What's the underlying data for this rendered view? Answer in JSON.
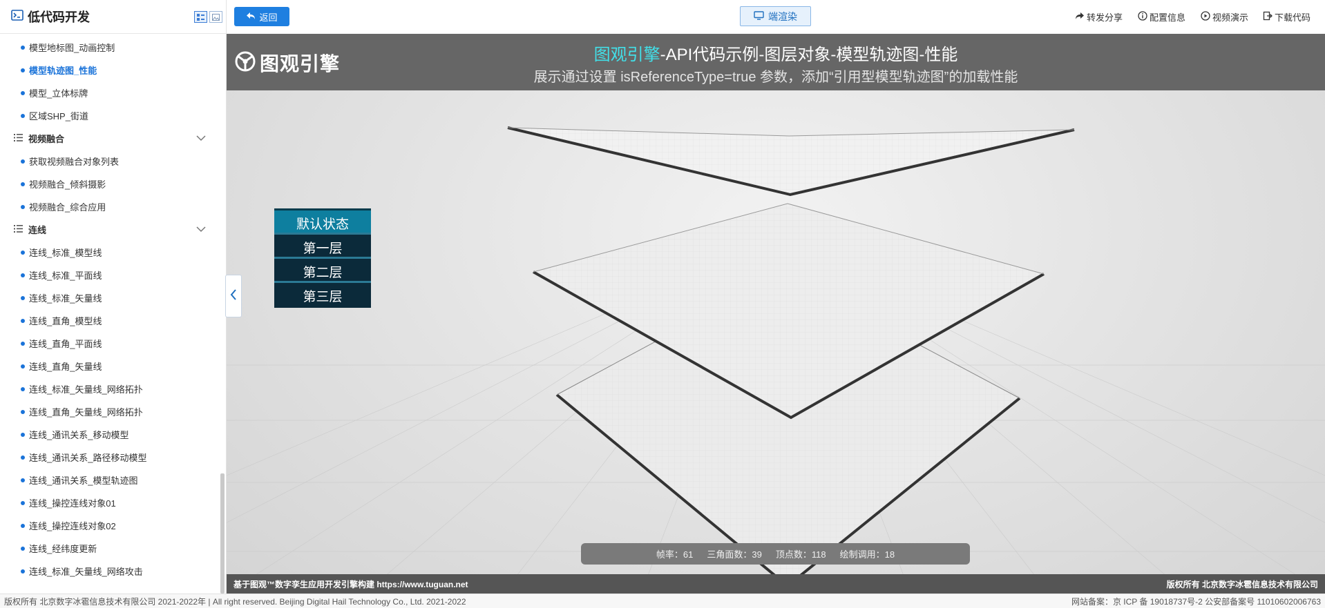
{
  "sidebar": {
    "title": "低代码开发",
    "items": [
      {
        "type": "item",
        "label": "模型地标图_动画控制"
      },
      {
        "type": "item",
        "label": "模型轨迹图_性能",
        "active": true
      },
      {
        "type": "item",
        "label": "模型_立体标牌"
      },
      {
        "type": "item",
        "label": "区域SHP_街道"
      },
      {
        "type": "group",
        "label": "视频融合"
      },
      {
        "type": "item",
        "label": "获取视频融合对象列表"
      },
      {
        "type": "item",
        "label": "视频融合_倾斜摄影"
      },
      {
        "type": "item",
        "label": "视频融合_综合应用"
      },
      {
        "type": "group",
        "label": "连线"
      },
      {
        "type": "item",
        "label": "连线_标准_模型线"
      },
      {
        "type": "item",
        "label": "连线_标准_平面线"
      },
      {
        "type": "item",
        "label": "连线_标准_矢量线"
      },
      {
        "type": "item",
        "label": "连线_直角_模型线"
      },
      {
        "type": "item",
        "label": "连线_直角_平面线"
      },
      {
        "type": "item",
        "label": "连线_直角_矢量线"
      },
      {
        "type": "item",
        "label": "连线_标准_矢量线_网络拓扑"
      },
      {
        "type": "item",
        "label": "连线_直角_矢量线_网络拓扑"
      },
      {
        "type": "item",
        "label": "连线_通讯关系_移动模型"
      },
      {
        "type": "item",
        "label": "连线_通讯关系_路径移动模型"
      },
      {
        "type": "item",
        "label": "连线_通讯关系_模型轨迹图"
      },
      {
        "type": "item",
        "label": "连线_操控连线对象01"
      },
      {
        "type": "item",
        "label": "连线_操控连线对象02"
      },
      {
        "type": "item",
        "label": "连线_经纬度更新"
      },
      {
        "type": "item",
        "label": "连线_标准_矢量线_网络攻击"
      }
    ]
  },
  "toolbar": {
    "back_label": "返回",
    "render_label": "端渲染",
    "actions": [
      "转发分享",
      "配置信息",
      "视频演示",
      "下载代码"
    ]
  },
  "scene": {
    "logo_text": "图观引擎",
    "title_highlight": "图观引擎",
    "title_rest": "-API代码示例-图层对象-模型轨迹图-性能",
    "subtitle": "展示通过设置 isReferenceType=true 参数，添加“引用型模型轨迹图”的加载性能",
    "layer_buttons": [
      "默认状态",
      "第一层",
      "第二层",
      "第三层"
    ],
    "stats": [
      {
        "label": "帧率",
        "value": "61"
      },
      {
        "label": "三角面数",
        "value": "39"
      },
      {
        "label": "顶点数",
        "value": "118"
      },
      {
        "label": "绘制调用",
        "value": "18"
      }
    ],
    "footer_left": "基于图观™数字孪生应用开发引擎构建 https://www.tuguan.net",
    "footer_right": "版权所有 北京数字冰雹信息技术有限公司"
  },
  "page_footer": {
    "left": "版权所有 北京数字冰雹信息技术有限公司 2021-2022年 | All right reserved. Beijing Digital Hail Technology Co., Ltd. 2021-2022",
    "right": "网站备案：京 ICP 备 19018737号-2 公安部备案号 11010602006763"
  },
  "colors": {
    "accent": "#1e7fe0",
    "title_highlight": "#42e0e9",
    "layer_button": "#0b2a3a",
    "layer_button_active": "#0e7f9f"
  }
}
